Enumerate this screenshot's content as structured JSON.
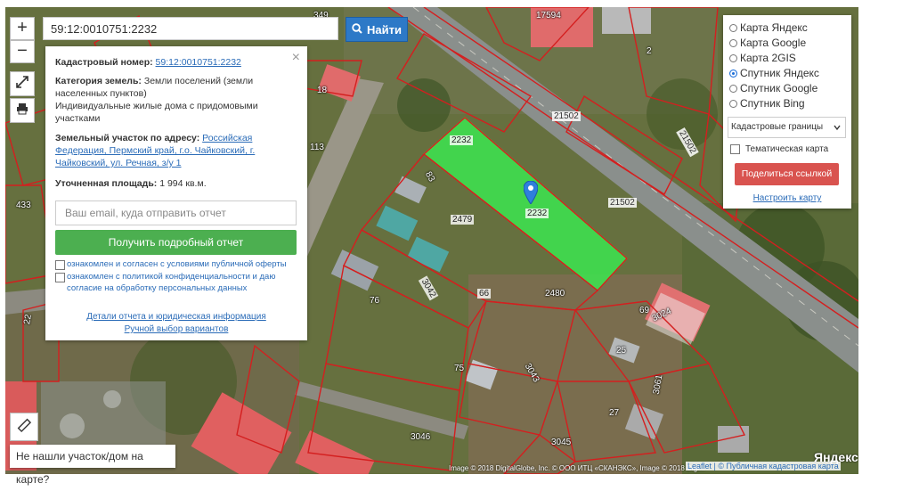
{
  "search": {
    "value": "59:12:0010751:2232",
    "button_label": "Найти"
  },
  "map": {
    "zoom_in": "+",
    "zoom_out": "−",
    "plot_labels": {
      "p17594": "17594",
      "p2": "2",
      "p349": "349",
      "p18": "18",
      "p113": "113",
      "p433": "433",
      "p2232a": "2232",
      "p2232b": "2232",
      "p21502a": "21502",
      "p21502b": "21502",
      "p21502c": "21502",
      "p2479": "2479",
      "p83": "83",
      "p3042": "3042",
      "p66": "66",
      "p2480": "2480",
      "p76": "76",
      "p69": "69",
      "p3024": "3024",
      "p25": "25",
      "p75": "75",
      "p3043": "3043",
      "p3061": "3061",
      "p27": "27",
      "p3046": "3046",
      "p3045": "3045",
      "p22": "22"
    },
    "attribution": "Image © 2018 DigitalGlobe, Inc. © ООО ИТЦ «СКАНЭКС», Image © 2018 Digi...",
    "leaflet": "Leaflet | © Публичная кадастровая карта",
    "yandex_logo": "Яндекс",
    "not_found": "Не нашли участок/дом на карте?"
  },
  "info_panel": {
    "cad_number_label": "Кадастровый номер:",
    "cad_number": "59:12:0010751:2232",
    "category_label": "Категория земель:",
    "category_value": "Земли поселений (земли населенных пунктов)",
    "usage": "Индивидуальные жилые дома с придомовыми участками",
    "address_label": "Земельный участок по адресу:",
    "address_value": "Российская Федерация, Пермский край, г.о. Чайковский, г. Чайковский, ул. Речная, з/у 1",
    "area_label": "Уточненная площадь:",
    "area_value": "1 994 кв.м.",
    "email_placeholder": "Ваш email, куда отправить отчет",
    "report_button": "Получить подробный отчет",
    "consent1": "ознакомлен и согласен с условиями публичной оферты",
    "consent2": "ознакомлен с политикой конфиденциальности и даю согласие на обработку персональных данных",
    "details_link": "Детали отчета и юридическая информация",
    "manual_link": "Ручной выбор вариантов"
  },
  "layers_panel": {
    "options": [
      "Карта Яндекс",
      "Карта Google",
      "Карта 2GIS",
      "Спутник Яндекс",
      "Спутник Google",
      "Спутник Bing"
    ],
    "selected": "Спутник Яндекс",
    "select_value": "Кадастровые границы",
    "thematic": "Тематическая карта",
    "share_button": "Поделиться ссылкой",
    "configure_link": "Настроить карту"
  },
  "colors": {
    "highlight": "#3ce650",
    "boundary": "#d41f1f",
    "button_blue": "#2d79c7",
    "button_green": "#4caf50",
    "button_red": "#d9534f"
  }
}
